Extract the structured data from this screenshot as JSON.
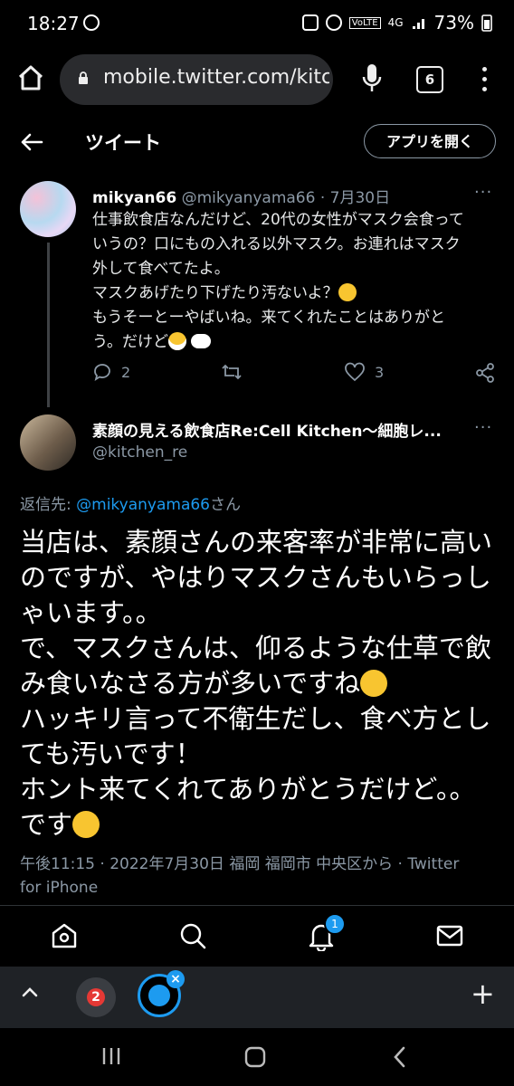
{
  "status_bar": {
    "time": "18:27",
    "lte": "VoLTE",
    "network": "4G",
    "battery": "73%"
  },
  "browser": {
    "url": "mobile.twitter.com/kitc",
    "tab_count": "6"
  },
  "header": {
    "title": "ツイート",
    "open_app_label": "アプリを開く"
  },
  "tweet1": {
    "name": "mikyan66",
    "handle": "@mikyanyama66",
    "date": "· 7月30日",
    "more": "···",
    "lines": [
      "仕事飲食店なんだけど、20代の女性がマスク会食って",
      "いうの？口にもの入れる以外マスク。お連れはマスク",
      "外して食べてたよ。",
      "マスクあげたり下げたり汚ないよ？",
      "もうそーとーやばいね。来てくれたことはありがと",
      "う。だけど"
    ],
    "reply_count": "2",
    "like_count": "3"
  },
  "tweet2": {
    "name": "素顔の見える飲食店Re:Cell Kitchen〜細胞レ...",
    "handle": "@kitchen_re",
    "more": "···",
    "reply_prefix": "返信先: ",
    "reply_link": "@mikyanyama66",
    "reply_suffix": "さん",
    "lines": [
      "当店は、素顔さんの来客率が非常に高い",
      "のですが、やはりマスクさんもいらっし",
      "ゃいます。。",
      "で、マスクさんは、仰るような仕草で飲",
      "み食いなさる方が多いですね",
      "ハッキリ言って不衛生だし、食べ方とし",
      "ても汚いです！",
      "ホント来てくれてありがとうだけど。。",
      "です"
    ],
    "meta_line1": "午後11:15 · 2022年7月30日 福岡 福岡市 中央区から · Twitter",
    "meta_line2": "for iPhone"
  },
  "bottom_nav": {
    "notification_badge": "1"
  },
  "tab_strip": {
    "tab1_label": "2",
    "close_label": "×",
    "new_tab_label": "+"
  },
  "colors": {
    "accent": "#1d9bf0",
    "muted": "#8b98a5",
    "background": "#000000"
  }
}
